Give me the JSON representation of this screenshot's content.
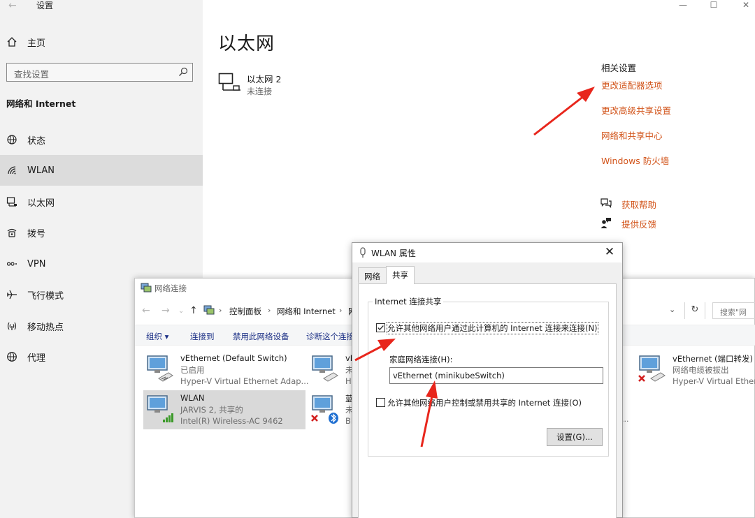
{
  "settings": {
    "title": "设置",
    "back_glyph": "←",
    "window_controls": {
      "minimize": "—",
      "maximize": "☐",
      "close": "✕"
    },
    "home_label": "主页",
    "search_placeholder": "查找设置",
    "category": "网络和 Internet",
    "nav": [
      {
        "label": "状态",
        "icon": "globe-icon"
      },
      {
        "label": "WLAN",
        "icon": "wifi-icon",
        "selected": true
      },
      {
        "label": "以太网",
        "icon": "ethernet-icon"
      },
      {
        "label": "拨号",
        "icon": "dialup-icon"
      },
      {
        "label": "VPN",
        "icon": "vpn-icon"
      },
      {
        "label": "飞行模式",
        "icon": "airplane-icon"
      },
      {
        "label": "移动热点",
        "icon": "hotspot-icon"
      },
      {
        "label": "代理",
        "icon": "proxy-globe-icon"
      }
    ],
    "page_title": "以太网",
    "ethernet_entry": {
      "name": "以太网 2",
      "status": "未连接"
    },
    "related_title": "相关设置",
    "related_links": [
      "更改适配器选项",
      "更改高级共享设置",
      "网络和共享中心",
      "Windows 防火墙"
    ],
    "help": {
      "get_help": "获取帮助",
      "feedback": "提供反馈"
    },
    "link_color": "#d2541a"
  },
  "netconn": {
    "title": "网络连接",
    "breadcrumb": [
      "控制面板",
      "网络和 Internet",
      "网"
    ],
    "search_placeholder": "搜索\"网",
    "toolbar": [
      "组织 ▾",
      "连接到",
      "禁用此网络设备",
      "诊断这个连接"
    ],
    "adapters": [
      {
        "name": "vEthernet (Default Switch)",
        "status": "已启用",
        "device": "Hyper-V Virtual Ethernet Adap..."
      },
      {
        "name": "vE",
        "status": "未",
        "device": "Hy"
      },
      {
        "name": "vEthernet (端口转发)",
        "status": "网络电缆被拔出",
        "device": "Hyper-V Virtual Ethern"
      },
      {
        "name": "WLAN",
        "status": "JARVIS 2, 共享的",
        "device": "Intel(R) Wireless-AC 9462",
        "selected": true
      },
      {
        "name": "蓝",
        "status": "未",
        "device": "Bl"
      }
    ],
    "truncated_mark": "..."
  },
  "dialog": {
    "title": "WLAN 属性",
    "tabs": [
      "网络",
      "共享"
    ],
    "active_tab": "共享",
    "group_title": "Internet 连接共享",
    "allow_share": {
      "label": "允许其他网络用户通过此计算机的 Internet 连接来连接(N)",
      "checked": true
    },
    "home_network_label": "家庭网络连接(H):",
    "home_network_value": "vEthernet (minikubeSwitch)",
    "allow_control": {
      "label": "允许其他网络用户控制或禁用共享的 Internet 连接(O)",
      "checked": false
    },
    "settings_button": "设置(G)..."
  },
  "annotation_color": "#e8261c"
}
